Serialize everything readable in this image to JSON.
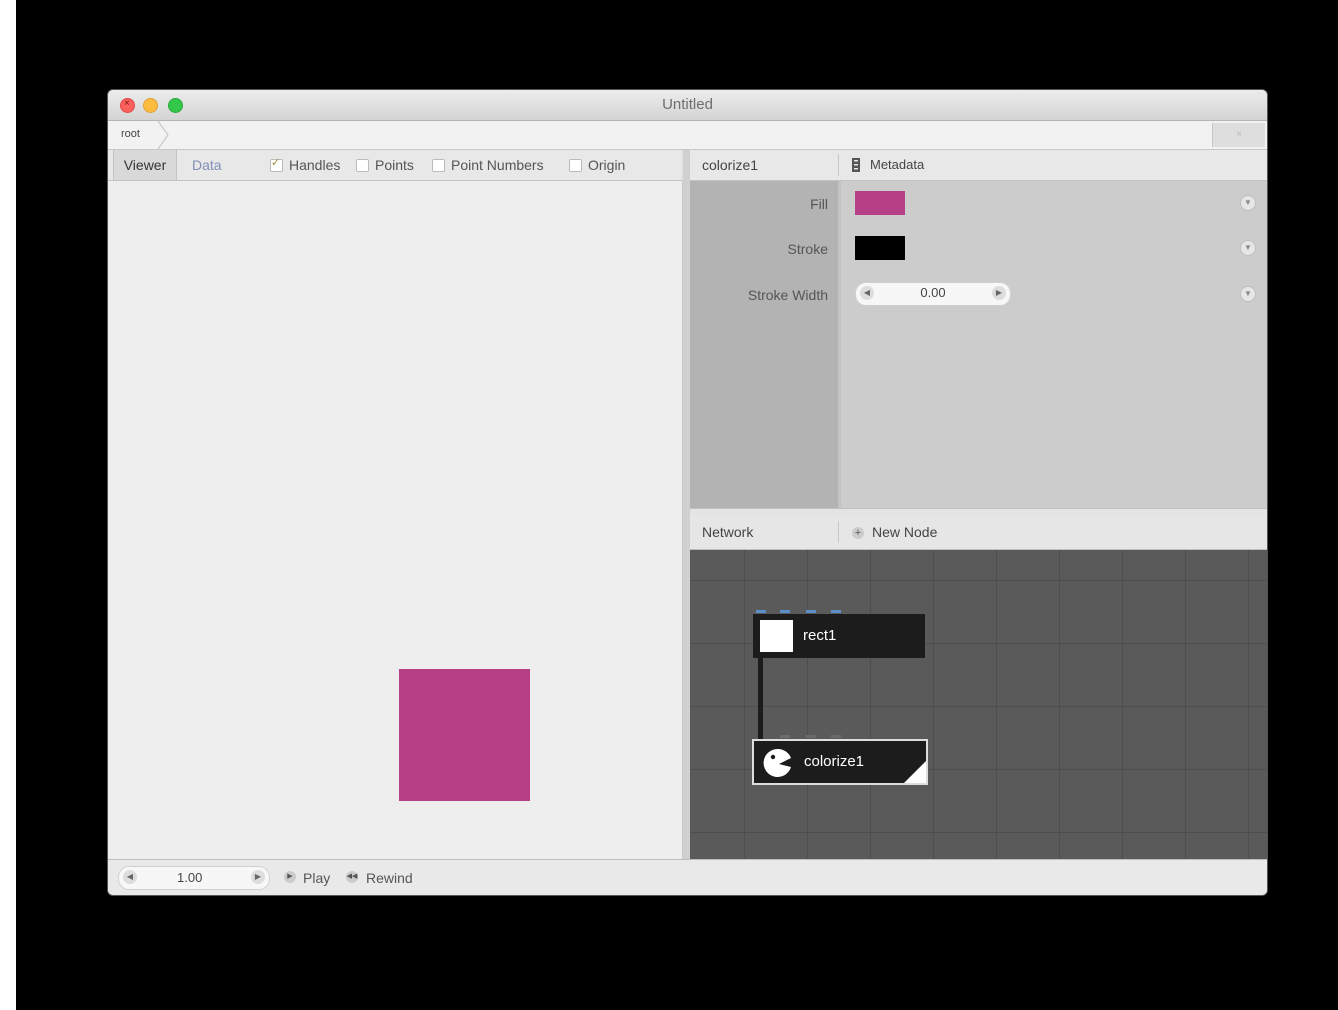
{
  "window": {
    "title": "Untitled"
  },
  "address": {
    "crumb": "root",
    "button": "×"
  },
  "viewer_tabs": {
    "viewer": "Viewer",
    "data": "Data",
    "options": [
      {
        "label": "Handles",
        "checked": true
      },
      {
        "label": "Points",
        "checked": false
      },
      {
        "label": "Point Numbers",
        "checked": false
      },
      {
        "label": "Origin",
        "checked": false
      }
    ]
  },
  "canvas": {
    "shape_color": "#b73f85"
  },
  "params": {
    "node_name": "colorize1",
    "metadata_label": "Metadata",
    "fill_label": "Fill",
    "fill_color": "#b73f85",
    "stroke_label": "Stroke",
    "stroke_color": "#000000",
    "stroke_width_label": "Stroke Width",
    "stroke_width_value": "0.00"
  },
  "network": {
    "label": "Network",
    "new_node_label": "New Node",
    "nodes": [
      {
        "name": "rect1"
      },
      {
        "name": "colorize1"
      }
    ]
  },
  "playback": {
    "frame": "1.00",
    "play_label": "Play",
    "rewind_label": "Rewind"
  }
}
